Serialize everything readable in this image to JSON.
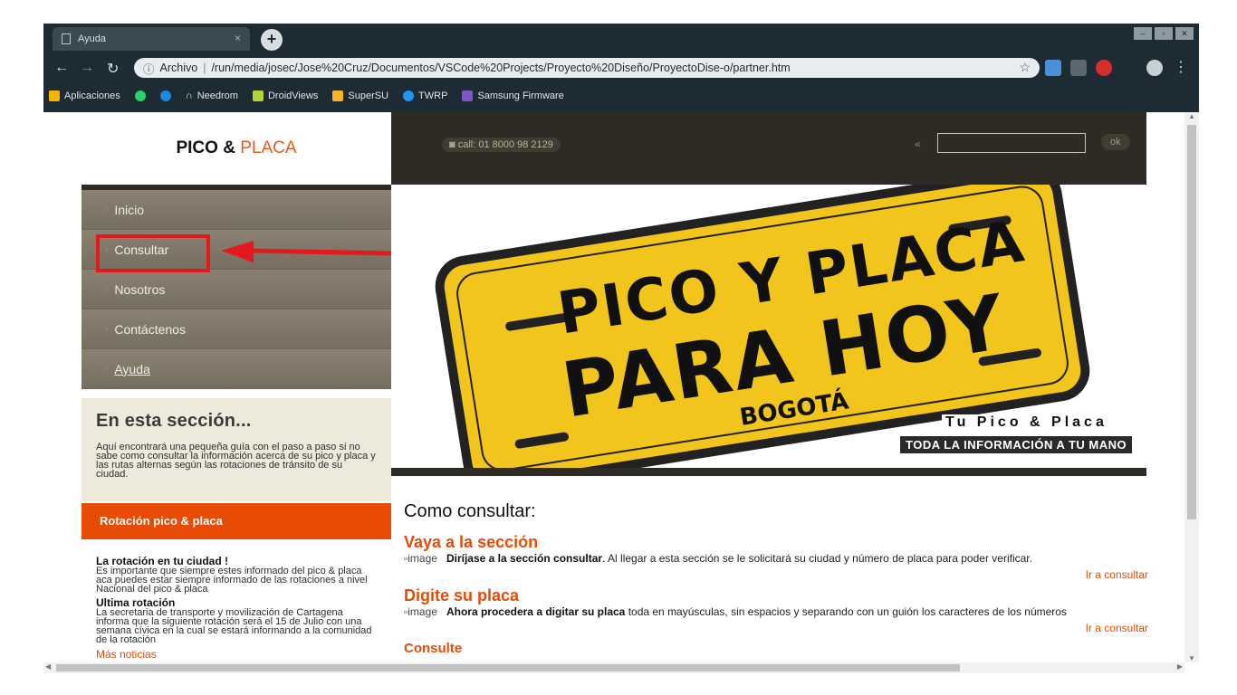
{
  "browser": {
    "tab_title": "Ayuda",
    "tab_close": "×",
    "new_tab": "+",
    "address_prefix": "Archivo",
    "url": "/run/media/josec/Jose%20Cruz/Documentos/VSCode%20Projects/Proyecto%20Diseño/ProyectoDise-o/partner.htm",
    "bookmarks": [
      {
        "label": "Aplicaciones",
        "icon": "apps-grid-icon",
        "color": "#f4b400"
      },
      {
        "label": "",
        "icon": "whatsapp-icon",
        "color": "#25d366"
      },
      {
        "label": "",
        "icon": "messenger-icon",
        "color": "#1e88e5"
      },
      {
        "label": "Needrom",
        "icon": "needrom-icon",
        "color": "#ffffff"
      },
      {
        "label": "DroidViews",
        "icon": "droidviews-icon",
        "color": "#b6d33a"
      },
      {
        "label": "SuperSU",
        "icon": "supersu-icon",
        "color": "#f7b32b"
      },
      {
        "label": "TWRP",
        "icon": "twrp-icon",
        "color": "#2196f3"
      },
      {
        "label": "Samsung Firmware",
        "icon": "samsung-firmware-icon",
        "color": "#7e57c2"
      }
    ]
  },
  "site": {
    "brand_main": "PICO",
    "brand_amp": " & ",
    "brand_accent": "PLACA",
    "call_text": "call: 01 8000 98 2129",
    "search_button": "ok",
    "menu": [
      {
        "label": "Inicio"
      },
      {
        "label": "Consultar"
      },
      {
        "label": "Nosotros"
      },
      {
        "label": "Contáctenos"
      },
      {
        "label": "Ayuda"
      }
    ],
    "section_title": "En esta sección...",
    "section_text": "Aquí encontrará una pequeña guía con el paso a paso si no sabe como consultar la información acerca de su pico y placa y las rutas alternas según las rotaciones de tránsito de su ciudad.",
    "rotation_title": "Rotación pico & placa",
    "news": [
      {
        "title": "La rotación en tu ciudad !",
        "text": "Es importante que siempre estes informado del pico & placa aca puedes estar siempre informado de las rotaciones a nivel Nacional del pico & placa"
      },
      {
        "title": "Ultima rotación",
        "text": "La secretaria de transporte y movilización de Cartagena informa que la siguiente rotación será el 15 de Julio con una semana cívica en la cual se estará informando a la comunidad de la rotación"
      }
    ],
    "more_news": "Más noticias",
    "banner": {
      "line1": "PICO Y PLACA",
      "line2": "PARA HOY",
      "line3": "BOGOTÁ",
      "tag1": "Tu Pico & Placa",
      "tag2": "TODA LA INFORMACIÓN A TU MANO"
    },
    "content": {
      "heading": "Como consultar:",
      "steps": [
        {
          "title": "Vaya a la sección",
          "img_alt": "image",
          "bold": "Diríjase a la sección consultar",
          "text": ". Al llegar a esta sección se le solicitará su ciudad y número de placa para poder verificar.",
          "link": "Ir a consultar"
        },
        {
          "title": "Digite su placa",
          "img_alt": "image",
          "bold": "Ahora procedera a digitar su placa",
          "text": " toda en mayúsculas, sin espacios y separando con un guión los caracteres de los números",
          "link": "Ir a consultar"
        }
      ],
      "next_title": "Consulte"
    }
  },
  "colors": {
    "accent": "#e84b06",
    "sidebar": "#7d7566",
    "header_dark": "#2d2b23",
    "plate_yellow": "#f2c51c",
    "highlight_red": "#e5191d"
  }
}
